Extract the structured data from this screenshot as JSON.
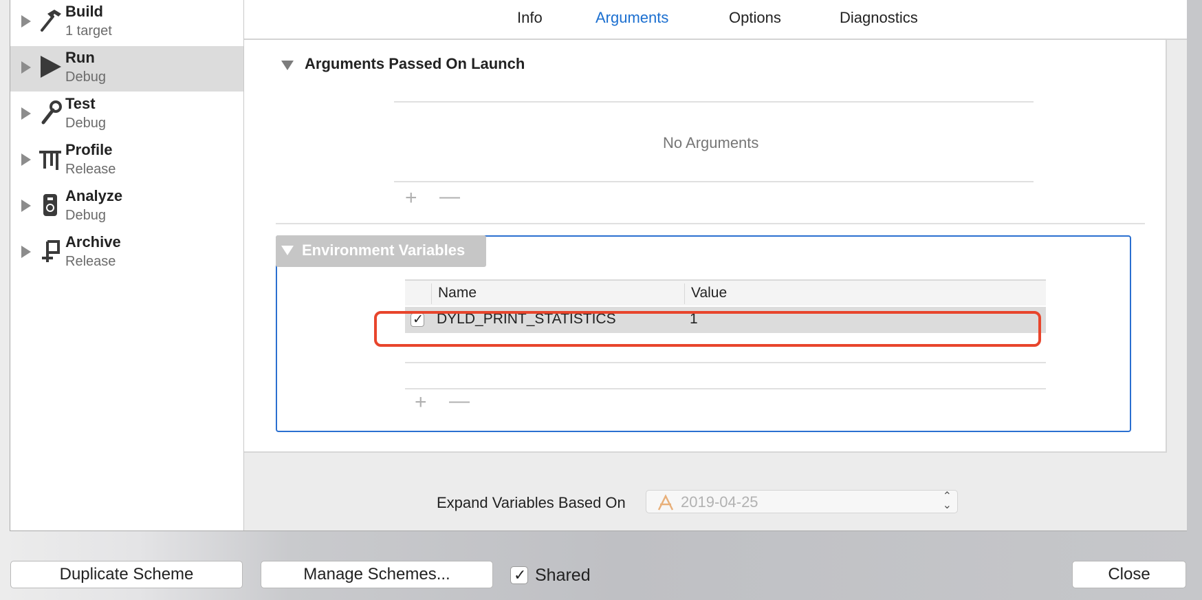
{
  "sidebar": {
    "items": [
      {
        "name": "Build",
        "sub": "1 target",
        "icon": "hammer-icon",
        "selected": false
      },
      {
        "name": "Run",
        "sub": "Debug",
        "icon": "play-icon",
        "selected": true
      },
      {
        "name": "Test",
        "sub": "Debug",
        "icon": "wrench-icon",
        "selected": false
      },
      {
        "name": "Profile",
        "sub": "Release",
        "icon": "profile-icon",
        "selected": false
      },
      {
        "name": "Analyze",
        "sub": "Debug",
        "icon": "analyze-icon",
        "selected": false
      },
      {
        "name": "Archive",
        "sub": "Release",
        "icon": "archive-icon",
        "selected": false
      }
    ]
  },
  "tabs": [
    "Info",
    "Arguments",
    "Options",
    "Diagnostics"
  ],
  "active_tab": "Arguments",
  "arguments": {
    "title": "Arguments Passed On Launch",
    "empty_text": "No Arguments",
    "add": "+",
    "remove": "—"
  },
  "environment": {
    "title": "Environment Variables",
    "columns": {
      "name": "Name",
      "value": "Value"
    },
    "rows": [
      {
        "enabled": true,
        "name": "DYLD_PRINT_STATISTICS",
        "value": "1"
      }
    ],
    "add": "+",
    "remove": "—"
  },
  "expand": {
    "label": "Expand Variables Based On",
    "value": "2019-04-25"
  },
  "footer": {
    "duplicate": "Duplicate Scheme",
    "manage": "Manage Schemes...",
    "shared_label": "Shared",
    "shared_checked": true,
    "close": "Close"
  },
  "colors": {
    "accent": "#1b6fd0",
    "highlight": "#e8452c"
  },
  "checkmark": "✓"
}
